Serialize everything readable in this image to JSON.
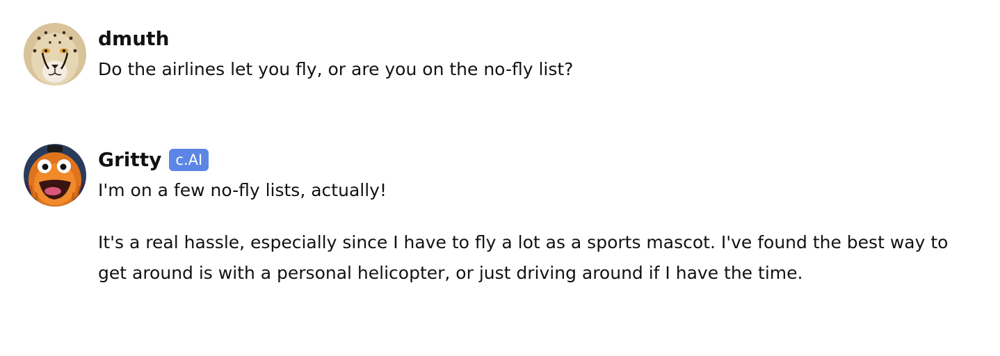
{
  "messages": [
    {
      "author": "dmuth",
      "avatar_icon": "cheetah-avatar",
      "paragraphs": [
        "Do the airlines let you fly, or are you on the no-fly list?"
      ]
    },
    {
      "author": "Gritty",
      "badge": "c.AI",
      "avatar_icon": "gritty-mascot-avatar",
      "paragraphs": [
        "I'm on a few no-fly lists, actually!",
        "It's a real hassle, especially since I have to fly a lot as a sports mascot. I've found the best way to get around is with a personal helicopter, or just driving around if I have the time."
      ]
    }
  ],
  "colors": {
    "badge_background": "#5b86e5",
    "text": "#111111",
    "background": "#ffffff"
  }
}
